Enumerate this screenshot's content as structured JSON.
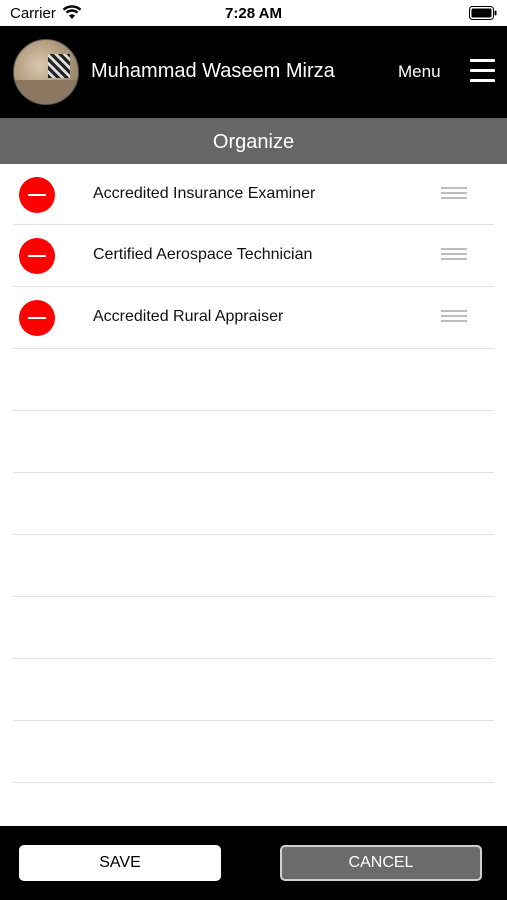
{
  "status_bar": {
    "carrier": "Carrier",
    "time": "7:28 AM",
    "wifi_icon": "wifi-icon",
    "battery_icon": "battery-icon"
  },
  "header": {
    "user_name": "Muhammad Waseem Mirza",
    "menu_label": "Menu",
    "menu_icon": "hamburger-icon",
    "avatar": "user-avatar-photo"
  },
  "section": {
    "title": "Organize"
  },
  "list": {
    "items": [
      {
        "label": "Accredited Insurance Examiner"
      },
      {
        "label": "Certified Aerospace Technician"
      },
      {
        "label": "Accredited Rural Appraiser"
      }
    ],
    "delete_icon": "minus-circle-icon",
    "reorder_icon": "drag-handle-icon"
  },
  "footer": {
    "save_label": "SAVE",
    "cancel_label": "CANCEL"
  },
  "colors": {
    "header_bg": "#000000",
    "section_bg": "#666666",
    "delete_red": "#ff0000",
    "cancel_bg": "#6b6b6b"
  }
}
